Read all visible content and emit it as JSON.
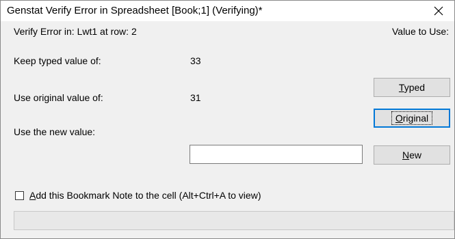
{
  "window": {
    "title": "Genstat Verify Error in Spreadsheet [Book;1] (Verifying)*",
    "close_icon": "close-icon"
  },
  "header": {
    "error_location": "Verify Error in: Lwt1 at row: 2",
    "value_to_use_label": "Value to Use:"
  },
  "rows": {
    "typed": {
      "label": "Keep typed value of:",
      "value": "33",
      "button_mnemonic": "T",
      "button_rest": "yped"
    },
    "original": {
      "label": "Use original value of:",
      "value": "31",
      "button_mnemonic": "O",
      "button_rest": "riginal"
    },
    "new": {
      "label": "Use the new value:",
      "input_value": "",
      "button_mnemonic": "N",
      "button_rest": "ew"
    }
  },
  "bookmark": {
    "checked": false,
    "label_mnemonic": "A",
    "label_rest": "dd this Bookmark Note to the cell (Alt+Ctrl+A to view)"
  },
  "status_bar": {
    "text": ""
  },
  "colors": {
    "dialog_bg": "#f0f0f0",
    "titlebar_bg": "#ffffff",
    "button_bg": "#e1e1e1",
    "focus_border": "#0078d7"
  }
}
